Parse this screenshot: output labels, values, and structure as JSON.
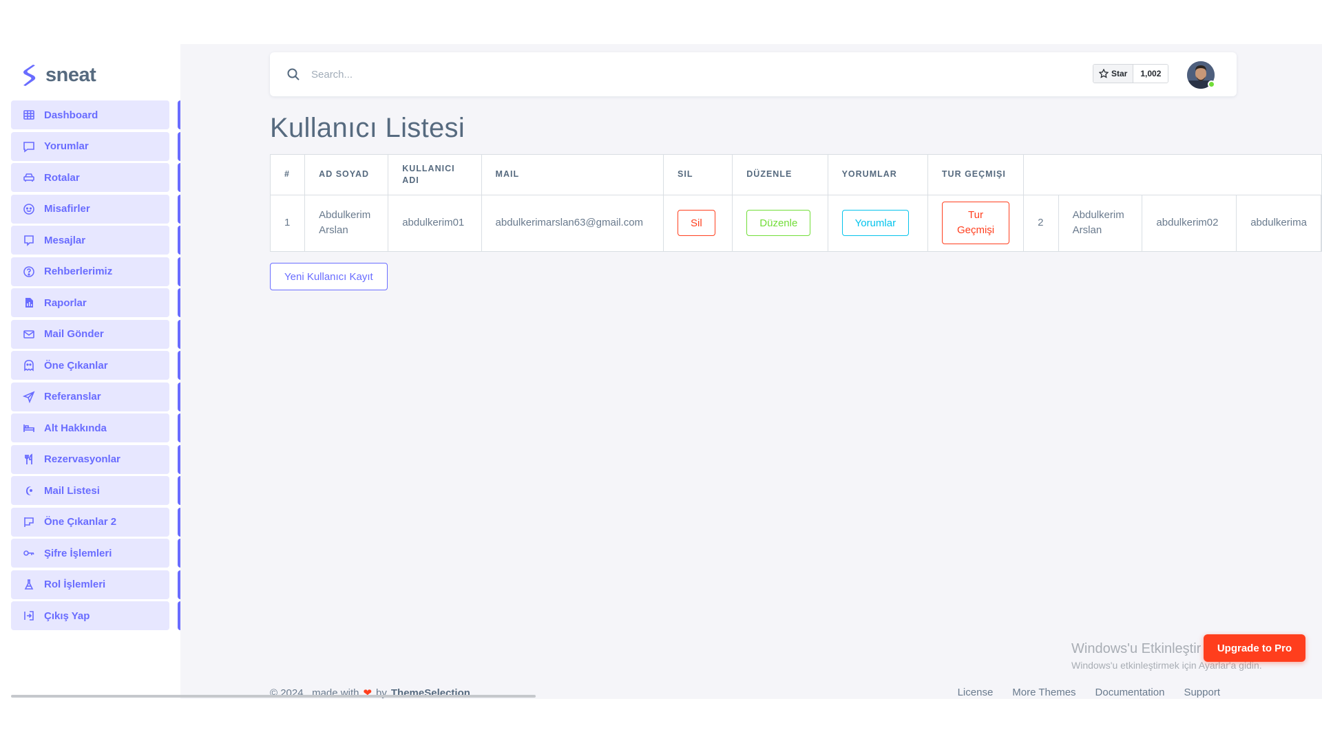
{
  "brand": {
    "name": "sneat"
  },
  "sidebar": {
    "items": [
      {
        "label": "Dashboard",
        "icon": "grid-icon"
      },
      {
        "label": "Yorumlar",
        "icon": "chat-icon"
      },
      {
        "label": "Rotalar",
        "icon": "car-icon"
      },
      {
        "label": "Misafirler",
        "icon": "smile-icon"
      },
      {
        "label": "Mesajlar",
        "icon": "message-icon"
      },
      {
        "label": "Rehberlerimiz",
        "icon": "help-circle-icon"
      },
      {
        "label": "Raporlar",
        "icon": "report-file-icon"
      },
      {
        "label": "Mail Gönder",
        "icon": "envelope-icon"
      },
      {
        "label": "Öne Çıkanlar",
        "icon": "ghost-icon"
      },
      {
        "label": "Referanslar",
        "icon": "send-icon"
      },
      {
        "label": "Alt Hakkında",
        "icon": "bed-icon"
      },
      {
        "label": "Rezervasyonlar",
        "icon": "restaurant-icon"
      },
      {
        "label": "Mail Listesi",
        "icon": "moon-icon"
      },
      {
        "label": "Öne Çıkanlar 2",
        "icon": "flag-icon"
      },
      {
        "label": "Şifre İşlemleri",
        "icon": "key-icon"
      },
      {
        "label": "Rol İşlemleri",
        "icon": "lab-icon"
      },
      {
        "label": "Çıkış Yap",
        "icon": "logout-icon"
      }
    ]
  },
  "navbar": {
    "search_placeholder": "Search...",
    "star_label": "Star",
    "star_count": "1,002"
  },
  "page": {
    "title": "Kullanıcı Listesi",
    "new_user_button": "Yeni Kullanıcı Kayıt"
  },
  "table": {
    "headers": [
      "#",
      "AD SOYAD",
      "KULLANICI ADI",
      "MAIL",
      "SIL",
      "DÜZENLE",
      "YORUMLAR",
      "TUR GEÇMIŞI"
    ],
    "row1": {
      "num": "1",
      "name": "Abdulkerim Arslan",
      "username": "abdulkerim01",
      "mail": "abdulkerimarslan63@gmail.com",
      "delete": "Sil",
      "edit": "Düzenle",
      "comments": "Yorumlar",
      "tour_history": "Tur Geçmişi"
    },
    "row2": {
      "num": "2",
      "name": "Abdulkerim Arslan",
      "username": "abdulkerim02",
      "mail": "abdulkerima"
    }
  },
  "footer": {
    "copyright": "© 2024 , made with",
    "by": "by",
    "brand": "ThemeSelection",
    "links": [
      "License",
      "More Themes",
      "Documentation",
      "Support"
    ]
  },
  "watermark": {
    "line1": "Windows'u Etkinleştir",
    "line2": "Windows'u etkinleştirmek için Ayarlar'a gidin."
  },
  "upgrade_button": "Upgrade to Pro",
  "colors": {
    "primary": "#696cff",
    "danger": "#ff3e1d",
    "success": "#71dd37",
    "info": "#03c3ec",
    "text": "#566a7f",
    "background": "#f5f5f9"
  }
}
